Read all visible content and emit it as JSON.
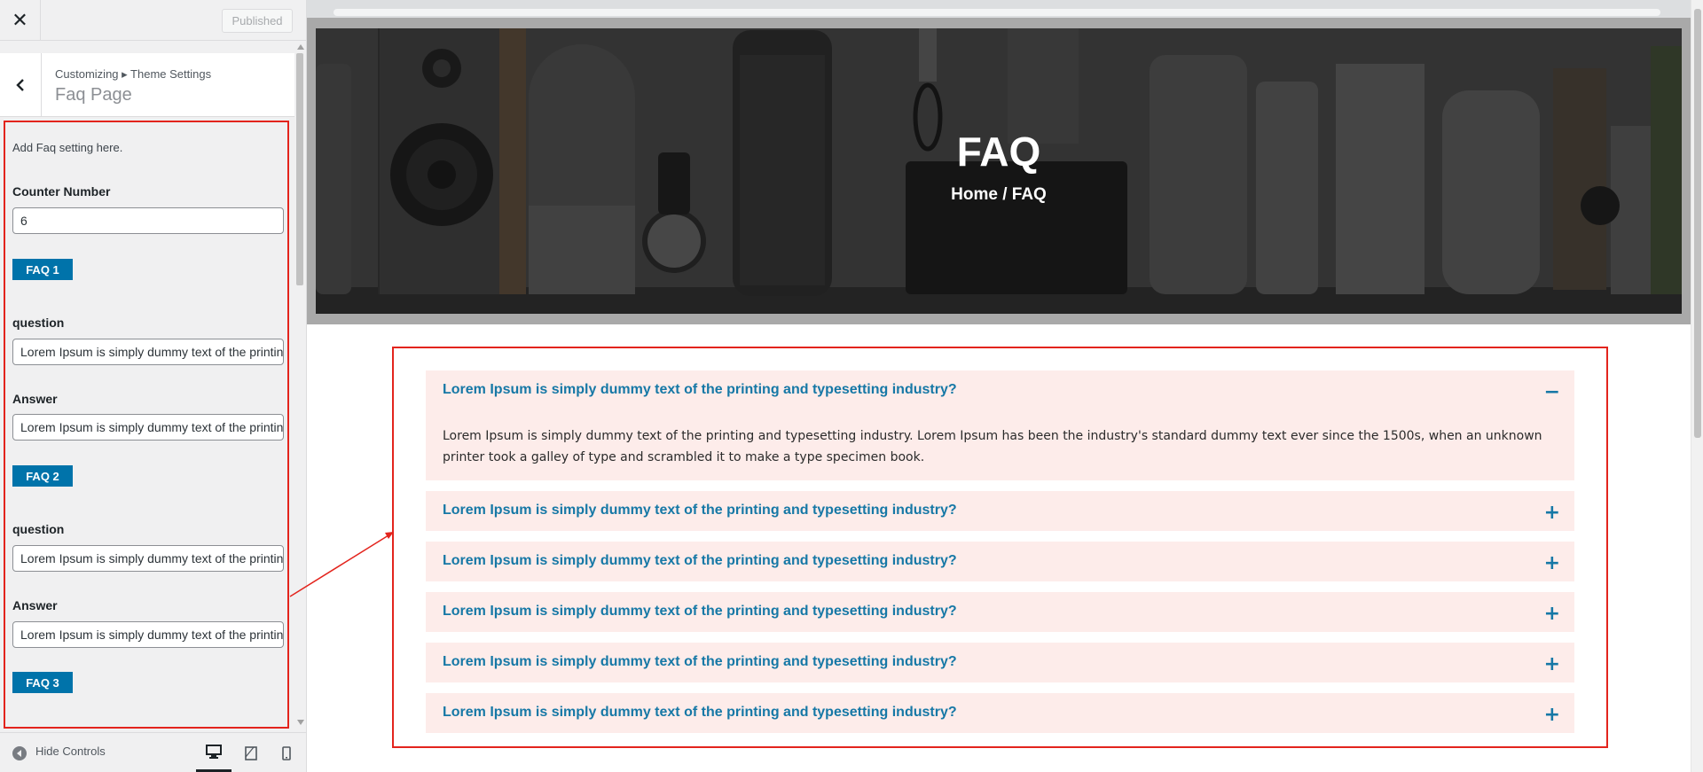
{
  "topbar": {
    "close_label": "✕",
    "publish_label": "Published"
  },
  "section": {
    "breadcrumb": "Customizing ▸ Theme Settings",
    "title": "Faq Page"
  },
  "controls": {
    "description": "Add Faq setting here.",
    "counter_label": "Counter Number",
    "counter_value": "6",
    "faqs": [
      {
        "tag": "FAQ 1",
        "question_label": "question",
        "question_value": "Lorem Ipsum is simply dummy text of the printing and typesetting industry?",
        "answer_label": "Answer",
        "answer_value": "Lorem Ipsum is simply dummy text of the printing and typesetting industry."
      },
      {
        "tag": "FAQ 2",
        "question_label": "question",
        "question_value": "Lorem Ipsum is simply dummy text of the printing and typesetting industry?",
        "answer_label": "Answer",
        "answer_value": "Lorem Ipsum is simply dummy text of the printing and typesetting industry."
      },
      {
        "tag": "FAQ 3"
      }
    ]
  },
  "footer": {
    "hide_controls": "Hide Controls"
  },
  "preview": {
    "hero_title": "FAQ",
    "hero_breadcrumb": "Home / FAQ",
    "items": [
      {
        "question": "Lorem Ipsum is simply dummy text of the printing and typesetting industry?",
        "answer": "Lorem Ipsum is simply dummy text of the printing and typesetting industry. Lorem Ipsum has been the industry's standard dummy text ever since the 1500s, when an unknown printer took a galley of type and scrambled it to make a type specimen book.",
        "toggle": "−"
      },
      {
        "question": "Lorem Ipsum is simply dummy text of the printing and typesetting industry?",
        "toggle": "+"
      },
      {
        "question": "Lorem Ipsum is simply dummy text of the printing and typesetting industry?",
        "toggle": "+"
      },
      {
        "question": "Lorem Ipsum is simply dummy text of the printing and typesetting industry?",
        "toggle": "+"
      },
      {
        "question": "Lorem Ipsum is simply dummy text of the printing and typesetting industry?",
        "toggle": "+"
      },
      {
        "question": "Lorem Ipsum is simply dummy text of the printing and typesetting industry?",
        "toggle": "+"
      }
    ]
  },
  "colors": {
    "accent": "#1678a6",
    "tag": "#0073aa",
    "item_bg": "#fdecea",
    "annotation": "#e3241d"
  }
}
